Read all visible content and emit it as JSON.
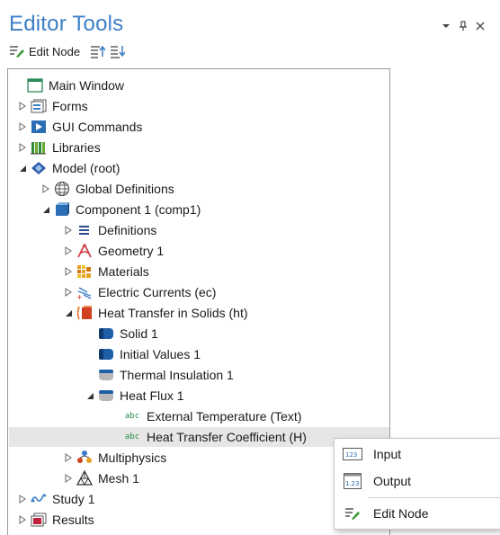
{
  "panel": {
    "title": "Editor Tools"
  },
  "toolbar": {
    "edit_node_label": "Edit Node"
  },
  "tree": {
    "main_window": "Main Window",
    "forms": "Forms",
    "gui_commands": "GUI Commands",
    "libraries": "Libraries",
    "model_root": "Model (root)",
    "global_definitions": "Global Definitions",
    "component1": "Component 1 (comp1)",
    "definitions": "Definitions",
    "geometry1": "Geometry 1",
    "materials": "Materials",
    "electric_currents": "Electric Currents (ec)",
    "heat_transfer": "Heat Transfer in Solids (ht)",
    "solid1": "Solid 1",
    "initial_values1": "Initial Values 1",
    "thermal_insulation1": "Thermal Insulation 1",
    "heat_flux1": "Heat Flux 1",
    "abc_prefix": "abc",
    "external_temperature": "External Temperature (Text)",
    "heat_transfer_coefficient": "Heat Transfer Coefficient (H)",
    "multiphysics": "Multiphysics",
    "mesh1": "Mesh 1",
    "study1": "Study 1",
    "results": "Results"
  },
  "context_menu": {
    "input": "Input",
    "input_icon_text": "123",
    "output": "Output",
    "output_icon_text": "1.23",
    "edit_node": "Edit Node"
  },
  "colors": {
    "title_blue": "#3d7fc6",
    "selected_bg": "#e6e6e6"
  }
}
